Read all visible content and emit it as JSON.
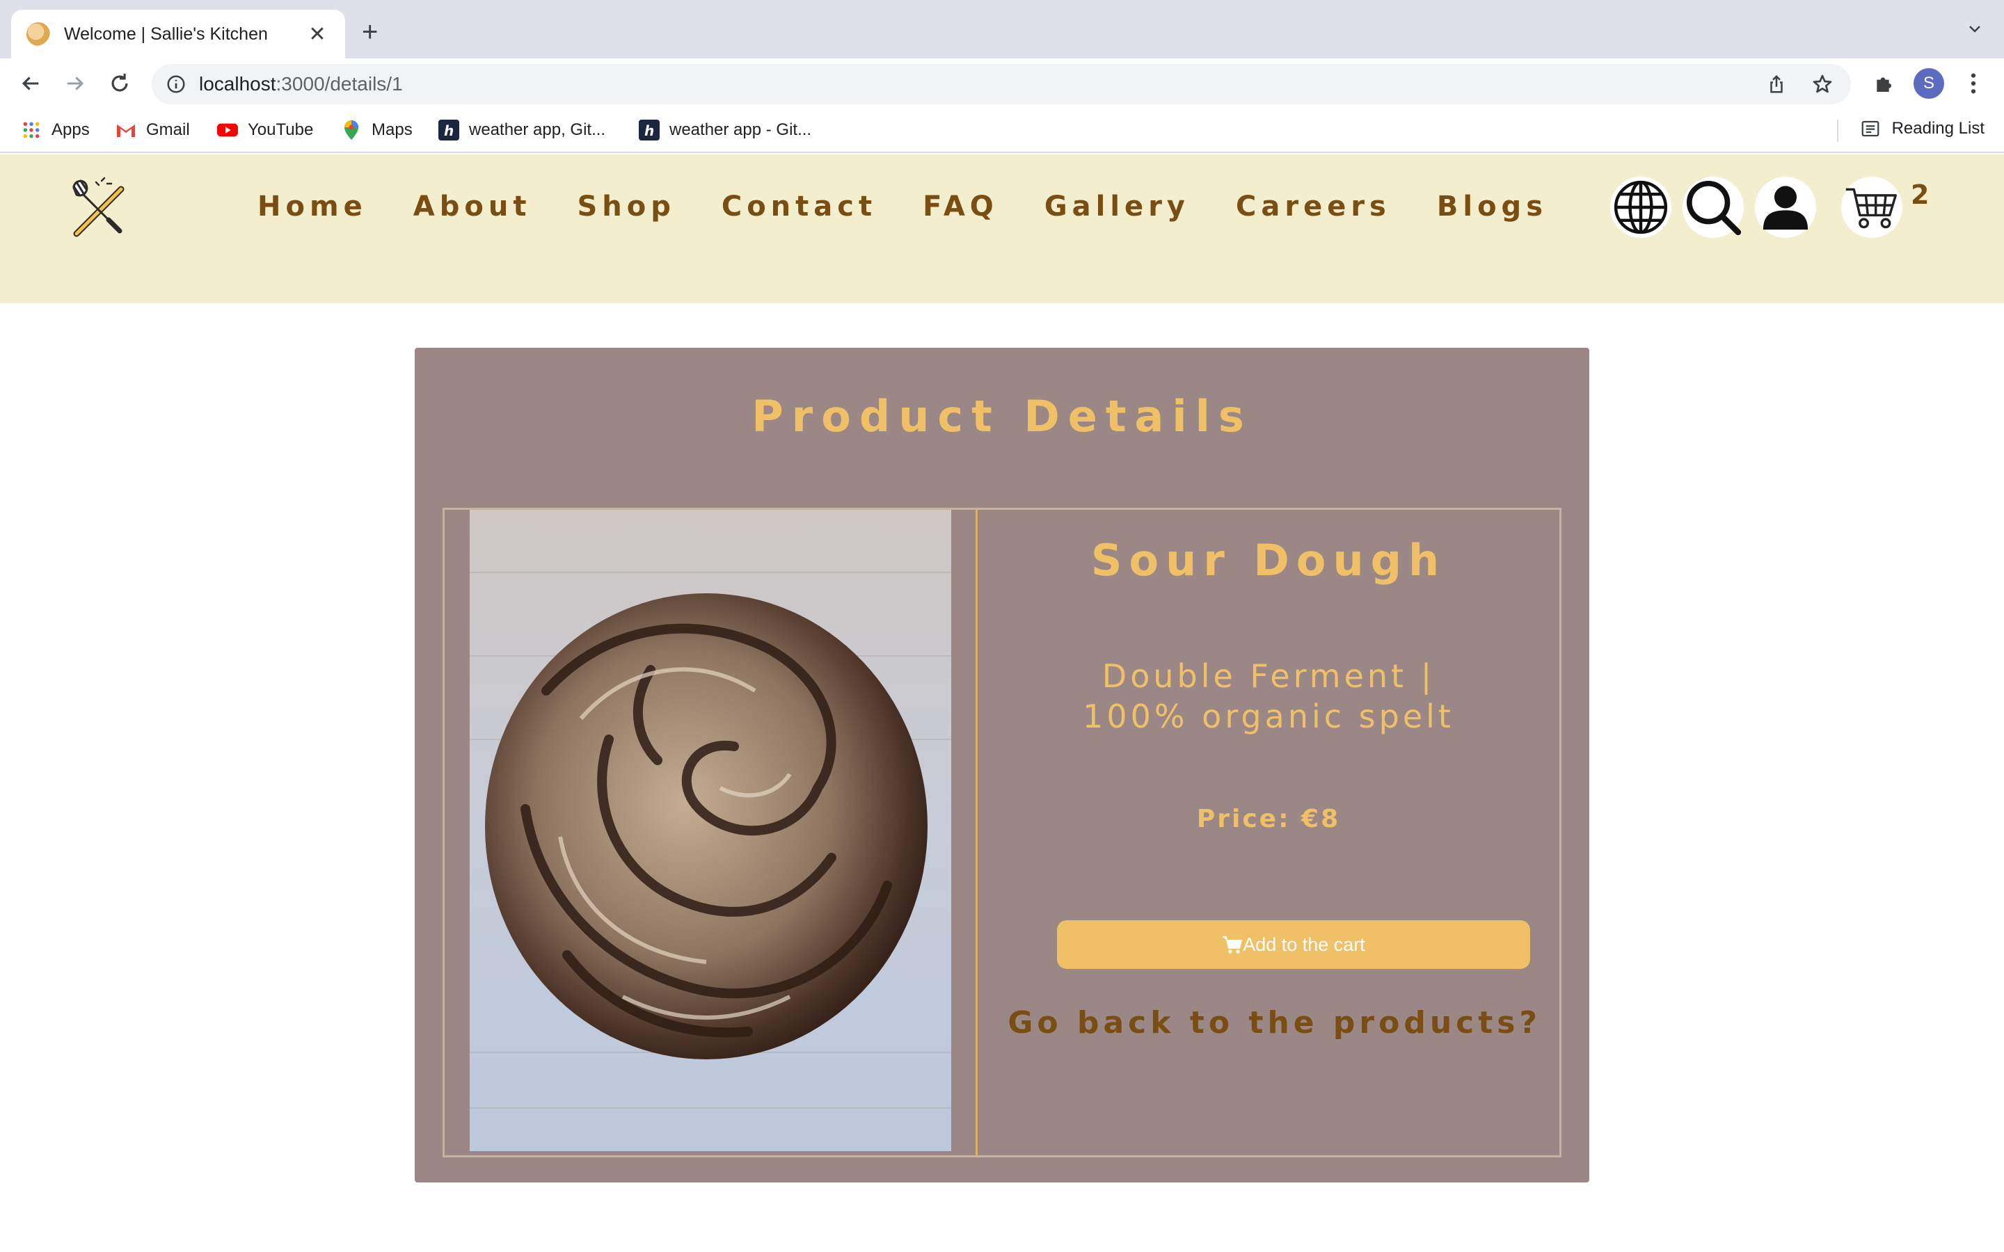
{
  "browser": {
    "tab_title": "Welcome | Sallie's Kitchen",
    "url_host": "localhost",
    "url_path": ":3000/details/1",
    "profile_initial": "S",
    "bookmarks": [
      {
        "label": "Apps",
        "icon": "apps-grid-icon"
      },
      {
        "label": "Gmail",
        "icon": "gmail-icon"
      },
      {
        "label": "YouTube",
        "icon": "youtube-icon"
      },
      {
        "label": "Maps",
        "icon": "maps-pin-icon"
      },
      {
        "label": "weather app, Git...",
        "icon": "hashnode-icon"
      },
      {
        "label": "weather app - Git...",
        "icon": "hashnode-icon"
      }
    ],
    "reading_list": "Reading List"
  },
  "site": {
    "nav": [
      "Home",
      "About",
      "Shop",
      "Contact",
      "FAQ",
      "Gallery",
      "Careers",
      "Blogs"
    ],
    "cart_count": "2",
    "colors": {
      "header_bg": "#f3efce",
      "nav_text": "#7a4e12",
      "accent": "#efc066",
      "card_bg": "#9b8886"
    }
  },
  "product": {
    "section_title": "Product Details",
    "name": "Sour Dough",
    "description": "Double Ferment | 100% organic spelt",
    "price": "Price: €8",
    "add_to_cart": "Add to the cart",
    "back_link": "Go back to the products?"
  }
}
